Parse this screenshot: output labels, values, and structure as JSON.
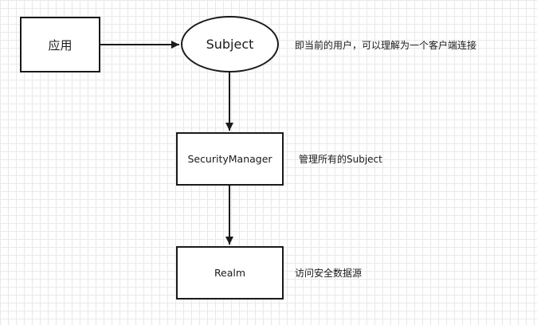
{
  "diagram": {
    "nodes": {
      "app": {
        "label": "应用"
      },
      "subject": {
        "label": "Subject",
        "note": "即当前的用户，可以理解为一个客户端连接"
      },
      "security_manager": {
        "label": "SecurityManager",
        "note": "管理所有的Subject"
      },
      "realm": {
        "label": "Realm",
        "note": "访问安全数据源"
      }
    },
    "edges": [
      {
        "from": "应用",
        "to": "Subject"
      },
      {
        "from": "Subject",
        "to": "SecurityManager"
      },
      {
        "from": "SecurityManager",
        "to": "Realm"
      }
    ]
  },
  "colors": {
    "stroke": "#1a1a1a",
    "grid": "#e9e9e9",
    "background": "#ffffff"
  }
}
